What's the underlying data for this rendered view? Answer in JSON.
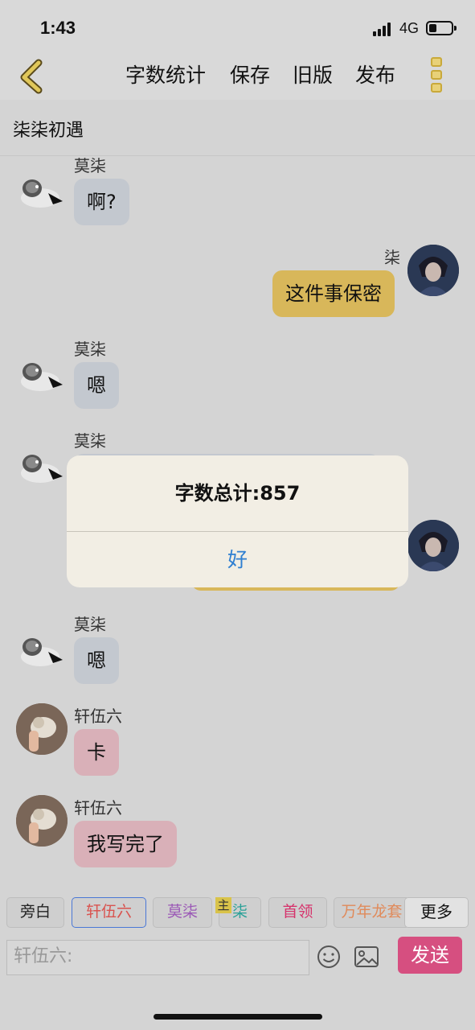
{
  "status_bar": {
    "time": "1:43",
    "network": "4G"
  },
  "nav": {
    "back_icon": "chevron-left-icon",
    "items": [
      "字数统计",
      "保存",
      "旧版",
      "发布"
    ],
    "menu_icon": "more-vertical-icon"
  },
  "chat_title": "柒柒初遇",
  "messages": [
    {
      "sender": "莫柒",
      "text": "啊?",
      "side": "left",
      "bubble_color": "#c3c8cf"
    },
    {
      "sender": "柒",
      "text": "这件事保密",
      "side": "right",
      "bubble_color": "#d8b75a"
    },
    {
      "sender": "莫柒",
      "text": "嗯",
      "side": "left",
      "bubble_color": "#c3c8cf"
    },
    {
      "sender": "莫柒",
      "text": "",
      "side": "left",
      "bubble_color": "#c3c8cf"
    },
    {
      "sender": "",
      "text": "",
      "side": "right",
      "bubble_color": "#d8b75a"
    },
    {
      "sender": "莫柒",
      "text": "嗯",
      "side": "left",
      "bubble_color": "#c3c8cf"
    },
    {
      "sender": "轩伍六",
      "text": "卡",
      "side": "left",
      "bubble_color": "#d9b0b8"
    },
    {
      "sender": "轩伍六",
      "text": "我写完了",
      "side": "left",
      "bubble_color": "#d9b0b8"
    }
  ],
  "dialog": {
    "message": "字数总计:857",
    "ok_label": "好"
  },
  "roles": [
    {
      "label": "旁白",
      "color": "#222222"
    },
    {
      "label": "轩伍六",
      "color": "#d9534f"
    },
    {
      "label": "莫柒",
      "color": "#9b59b6"
    },
    {
      "label": "柒",
      "color": "#2aa198"
    },
    {
      "label": "首领",
      "color": "#d6336c"
    },
    {
      "label": "万年龙套",
      "color": "#e08a5a"
    }
  ],
  "main_tag": "主",
  "more_label": "更多",
  "input": {
    "placeholder": "轩伍六:"
  },
  "send_label": "发送",
  "colors": {
    "accent": "#d64f80",
    "nav_gold": "#c9a93a",
    "dialog_link": "#2f7fd1"
  }
}
